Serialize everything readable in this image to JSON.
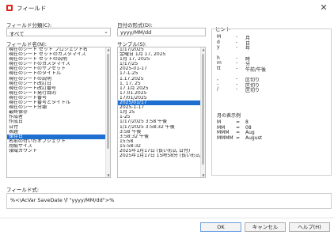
{
  "window": {
    "title": "フィールド"
  },
  "left": {
    "category_label": "フィールド分類(C):",
    "category_value": "すべて",
    "names_label": "フィールド名(N):",
    "names": [
      "現在のシート セット プロジェクト名",
      "現在のシート セットのカスタマイズ",
      "現在のシート セットの説明",
      "現在のシートのカスタマイズ",
      "現在のシートのサブセット",
      "現在のシートのタイトル",
      "現在のシートの説明",
      "現在のシート改訂日",
      "現在のシート改訂番号",
      "現在のシート発行目的",
      "現在のシート番号",
      "現在のシート番号とタイトル",
      "現在のシート分類",
      "最終保存",
      "作成者",
      "作成日",
      "日付",
      "表題",
      "保存日",
      "名前の付いたオブジェクト",
      "用紙サイズ",
      "領域カウント"
    ],
    "selected_name_index": 18
  },
  "middle": {
    "format_label": "日付の形式(D):",
    "format_value": "yyyy/MM/dd",
    "samples_label": "サンプル(S):",
    "samples": [
      "1/17/2025",
      "金曜日 1月 17, 2025",
      "1月 17, 2025",
      "1/17/25",
      "2025-01-17",
      "17-1-25",
      "1.17.2025",
      "1, 17, 25",
      "17 1月 2025",
      "17.01.2025",
      "17/01/2025",
      "2025/01/17",
      "2025-1-17",
      "1月 25",
      "1-25",
      "1/17/2025 3:58 午後",
      "1/17/2025 3:58:32 午後",
      "3:58 午後",
      "3:58:32 午後",
      "15:58",
      "15:58:32",
      "2025年1月17日 (長い形式 日付)",
      "2025年1月17日 15時58分 (長い形式..."
    ],
    "selected_sample_index": 11
  },
  "hint": {
    "title": "ヒント",
    "rows": [
      {
        "key": "M",
        "dash": "-",
        "desc": "月"
      },
      {
        "key": "d",
        "dash": "-",
        "desc": "日"
      },
      {
        "key": "y",
        "dash": "-",
        "desc": "年"
      },
      {
        "key": "h",
        "dash": "-",
        "desc": "時"
      },
      {
        "key": "m",
        "dash": "-",
        "desc": "分"
      },
      {
        "key": "tt",
        "dash": "-",
        "desc": "午前/午後"
      },
      {
        "key": ",",
        "dash": "-",
        "desc": "区切り"
      },
      {
        "key": "-",
        "dash": "-",
        "desc": "区切り"
      },
      {
        "key": "/",
        "dash": "-",
        "desc": "区切り"
      }
    ],
    "month_title": "月の表示例",
    "month_rows": [
      {
        "key": "M",
        "dash": "=",
        "desc": "8"
      },
      {
        "key": "MM",
        "dash": "=",
        "desc": "08"
      },
      {
        "key": "MMM",
        "dash": "=",
        "desc": "Aug"
      },
      {
        "key": "MMMM",
        "dash": "=",
        "desc": "August"
      }
    ]
  },
  "expression": {
    "label": "フィールド式:",
    "value": "%<\\AcVar SaveDate \\f \"yyyy/MM/dd\">%"
  },
  "buttons": {
    "ok": "OK",
    "cancel": "キャンセル",
    "help": "ヘルプ(H)"
  }
}
